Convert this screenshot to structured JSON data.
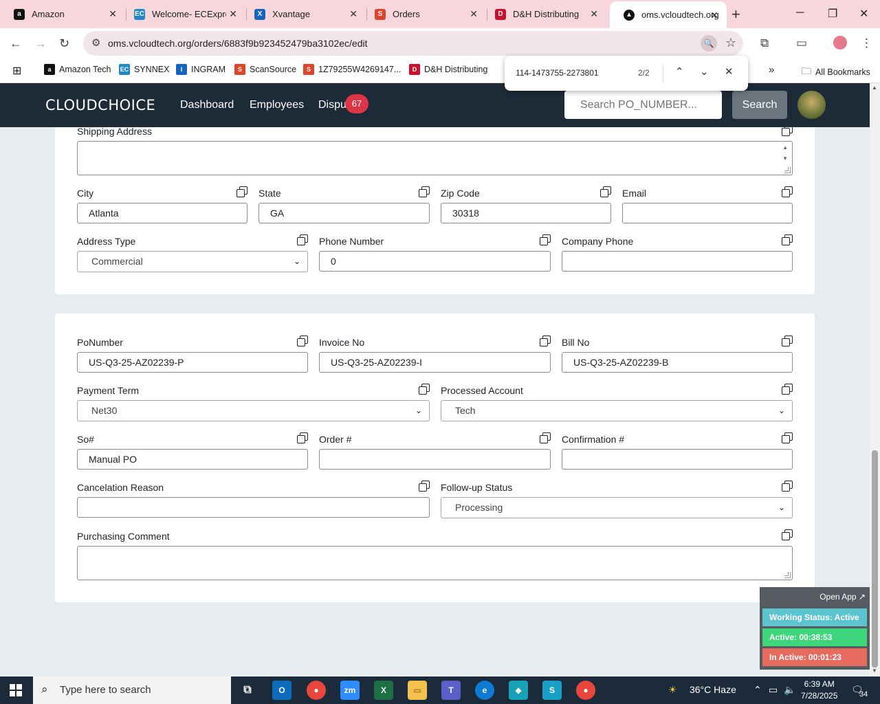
{
  "browser": {
    "tabs": [
      {
        "label": "Amazon",
        "icon": "amazon-icon",
        "color": "#111111"
      },
      {
        "label": "Welcome- ECExpress",
        "icon": "ec-icon",
        "color": "#1e88c9"
      },
      {
        "label": "Xvantage",
        "icon": "xvantage-icon",
        "color": "#1565c0"
      },
      {
        "label": "Orders",
        "icon": "orders-icon",
        "color": "#e0442b"
      },
      {
        "label": "D&H Distributing",
        "icon": "dh-icon",
        "color": "#c8102e"
      },
      {
        "label": "oms.vcloudtech.org",
        "icon": "oms-icon",
        "color": "#111111",
        "active": true
      }
    ],
    "url": "oms.vcloudtech.org/orders/6883f9b923452479ba3102ec/edit",
    "bookmarks": [
      {
        "label": "Amazon Tech",
        "icon": "amazon-icon",
        "color": "#111111"
      },
      {
        "label": "SYNNEX",
        "icon": "ec-icon",
        "color": "#1e88c9"
      },
      {
        "label": "INGRAM",
        "icon": "ingram-icon",
        "color": "#1565c0"
      },
      {
        "label": "ScanSource",
        "icon": "scansource-icon",
        "color": "#e0442b"
      },
      {
        "label": "1Z79255W4269147...",
        "icon": "ups-icon",
        "color": "#e0442b"
      },
      {
        "label": "D&H Distributing",
        "icon": "dh-icon",
        "color": "#c8102e"
      }
    ],
    "all_bookmarks": "All Bookmarks"
  },
  "find": {
    "query": "114-1473755-2273801",
    "count": "2/2"
  },
  "nav": {
    "logo": "CLOUDCHOICE",
    "links": [
      "Dashboard",
      "Employees",
      "Dispu"
    ],
    "badge": "67",
    "search_placeholder": "Search PO_NUMBER...",
    "search_button": "Search"
  },
  "address_section": {
    "shipping_address_label": "Shipping Address",
    "shipping_address_value": "",
    "city_label": "City",
    "city_value": "Atlanta",
    "state_label": "State",
    "state_value": "GA",
    "zip_label": "Zip Code",
    "zip_value": "30318",
    "email_label": "Email",
    "email_value": "",
    "address_type_label": "Address Type",
    "address_type_value": "Commercial",
    "phone_label": "Phone Number",
    "phone_value": "0",
    "company_phone_label": "Company Phone",
    "company_phone_value": ""
  },
  "order_section": {
    "po_label": "PoNumber",
    "po_value": "US-Q3-25-AZ02239-P",
    "invoice_label": "Invoice No",
    "invoice_value": "US-Q3-25-AZ02239-I",
    "bill_label": "Bill No",
    "bill_value": "US-Q3-25-AZ02239-B",
    "payment_term_label": "Payment Term",
    "payment_term_value": "Net30",
    "processed_account_label": "Processed Account",
    "processed_account_value": "Tech",
    "so_label": "So#",
    "so_value": "Manual PO",
    "order_label": "Order #",
    "order_value": "",
    "confirmation_label": "Confirmation #",
    "confirmation_value": "",
    "cancel_reason_label": "Cancelation Reason",
    "cancel_reason_value": "",
    "followup_label": "Follow-up Status",
    "followup_value": "Processing",
    "purchasing_comment_label": "Purchasing Comment",
    "purchasing_comment_value": ""
  },
  "status_widget": {
    "open_app": "Open App ↗",
    "working": "Working Status: Active",
    "active": "Active: 00:38:53",
    "inactive": "In Active: 00:01:23",
    "colors": {
      "working": "#5bc4cf",
      "active": "#3dd67a",
      "inactive": "#e76a5e"
    }
  },
  "taskbar": {
    "search_placeholder": "Type here to search",
    "weather": "36°C  Haze",
    "time": "6:39 AM",
    "date": "7/28/2025",
    "notifications": "34"
  }
}
